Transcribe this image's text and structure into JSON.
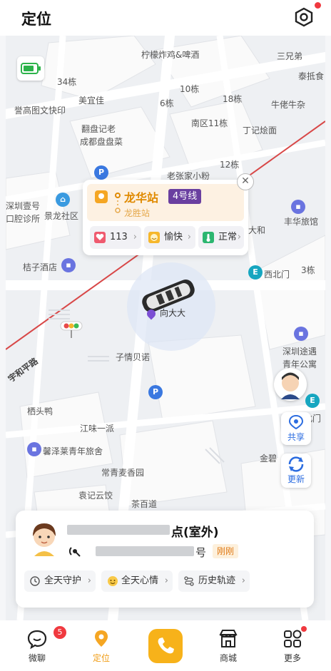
{
  "header": {
    "title": "定位"
  },
  "map": {
    "labels": [
      "柠檬炸鸡&啤酒",
      "三兄弟",
      "泰抵食",
      "34栋",
      "美宜佳",
      "10栋",
      "6栋",
      "18栋",
      "牛佬牛杂",
      "誉高图文快印",
      "翻盘记老",
      "成都盘盘菜",
      "南区11栋",
      "丁记烩面",
      "12栋",
      "老张家小粉",
      "深圳壹号",
      "口腔诊所",
      "景龙社区",
      "丰华旅馆",
      "大和",
      "桔子酒店",
      "西北门",
      "3栋",
      "向大大",
      "子情贝诺",
      "深圳途遇",
      "青年公寓",
      "栖头鸭",
      "江味一派",
      "馨泽莱青年旅舍",
      "常青麦香园",
      "袁记云饺",
      "茶百道",
      "宇和平路",
      "金碧",
      "北门"
    ]
  },
  "popup": {
    "station": "龙华站",
    "line": "4号线",
    "sub_station": "龙胜站",
    "heart_value": "113",
    "mood": "愉快",
    "temp": "正常"
  },
  "side_buttons": {
    "share": "共享",
    "refresh": "更新"
  },
  "card": {
    "name_suffix": "点(室外)",
    "number_suffix": "号",
    "time_badge": "刚刚",
    "actions": [
      "全天守护",
      "全天心情",
      "历史轨迹"
    ]
  },
  "tabbar": {
    "items": [
      "微聊",
      "定位",
      "",
      "商城",
      "更多"
    ],
    "chat_badge": "5"
  },
  "colors": {
    "accent": "#f7b21a",
    "metro": "#6a3fa0",
    "red": "#f0393f"
  }
}
